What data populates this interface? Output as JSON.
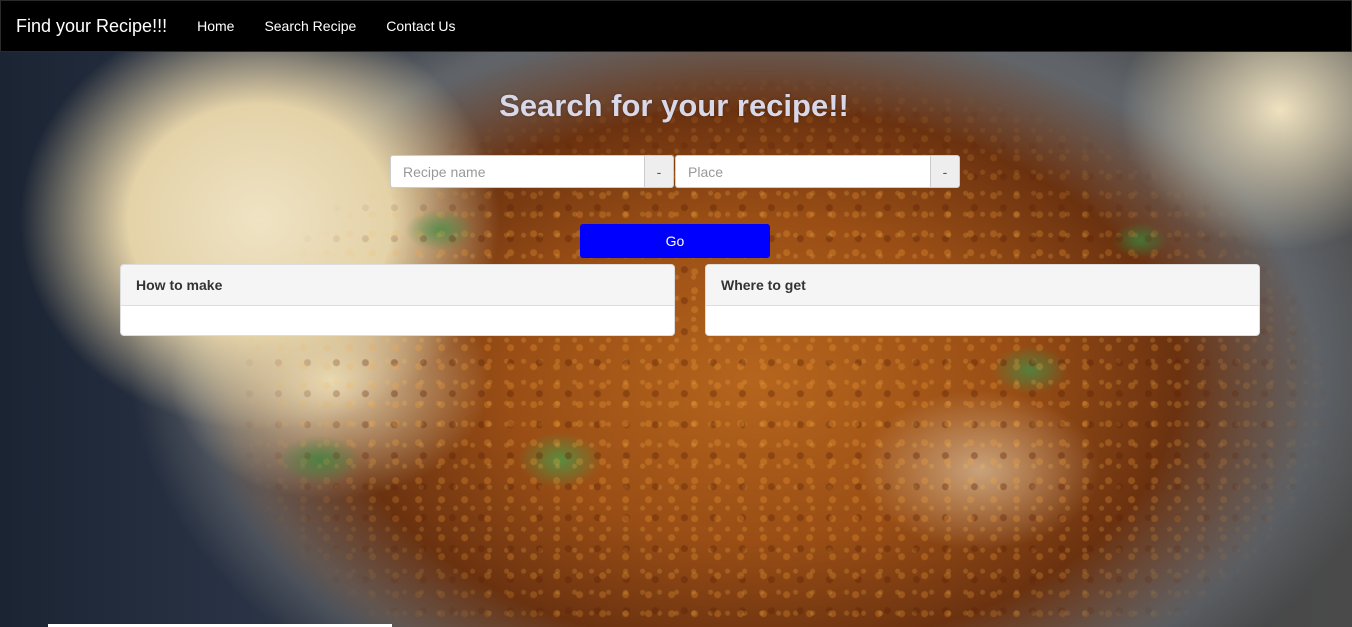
{
  "navbar": {
    "brand": "Find your Recipe!!!",
    "links": [
      "Home",
      "Search Recipe",
      "Contact Us"
    ]
  },
  "search": {
    "heading": "Search for your recipe!!",
    "recipe_placeholder": "Recipe name",
    "recipe_addon": "-",
    "place_placeholder": "Place",
    "place_addon": "-",
    "go_label": "Go"
  },
  "panels": {
    "how_to_make": "How to make",
    "where_to_get": "Where to get"
  },
  "colors": {
    "navbar_bg": "#000000",
    "go_button_bg": "#0000ff"
  }
}
